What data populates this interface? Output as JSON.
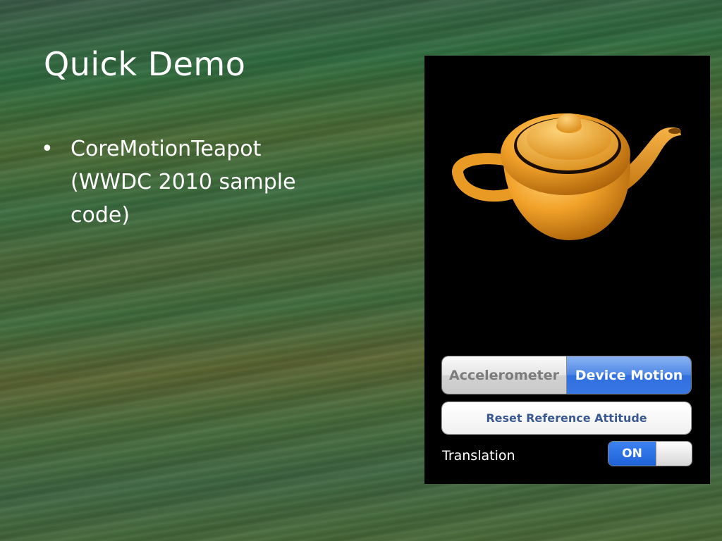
{
  "slide": {
    "title": "Quick Demo",
    "bullets": [
      {
        "text": "CoreMotionTeapot\n(WWDC 2010 sample\ncode)"
      }
    ]
  },
  "app": {
    "segmented_control": {
      "options": [
        "Accelerometer",
        "Device Motion"
      ],
      "selected": "Device Motion"
    },
    "reset_button_label": "Reset Reference Attitude",
    "translation_label": "Translation",
    "translation_switch": {
      "state_label": "ON",
      "on": true
    }
  },
  "colors": {
    "teapot": "#f0a020",
    "segment_selected": "#3977e3",
    "switch_on": "#2a6fe6",
    "reset_text": "#3b5a93"
  },
  "icons": {
    "bullet": "bullet-dot-icon"
  }
}
